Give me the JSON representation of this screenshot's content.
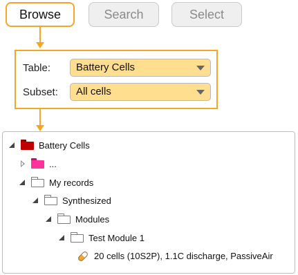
{
  "tabs": [
    {
      "label": "Browse",
      "state": "active"
    },
    {
      "label": "Search",
      "state": "inactive"
    },
    {
      "label": "Select",
      "state": "inactive"
    }
  ],
  "form": {
    "table_label": "Table:",
    "table_value": "Battery Cells",
    "subset_label": "Subset:",
    "subset_value": "All cells"
  },
  "tree": {
    "items": [
      {
        "label": "Battery Cells",
        "icon": "dark-red-folder-icon",
        "expander": "expanded"
      },
      {
        "label": "...",
        "icon": "pink-folder-icon",
        "expander": "collapsed"
      },
      {
        "label": "My records",
        "icon": "folder-icon",
        "expander": "expanded"
      },
      {
        "label": "Synthesized",
        "icon": "folder-icon",
        "expander": "expanded"
      },
      {
        "label": "Modules",
        "icon": "folder-icon",
        "expander": "expanded"
      },
      {
        "label": "Test Module 1",
        "icon": "folder-icon",
        "expander": "expanded"
      },
      {
        "label": "20 cells (10S2P), 1.1C discharge, PassiveAir",
        "icon": "record-capsule-icon",
        "expander": "none"
      }
    ]
  },
  "colors": {
    "accent": "#F5A623",
    "select_fill": "#FFDE8F",
    "root_folder": "#C00000",
    "pink_folder": "#FF3399"
  }
}
